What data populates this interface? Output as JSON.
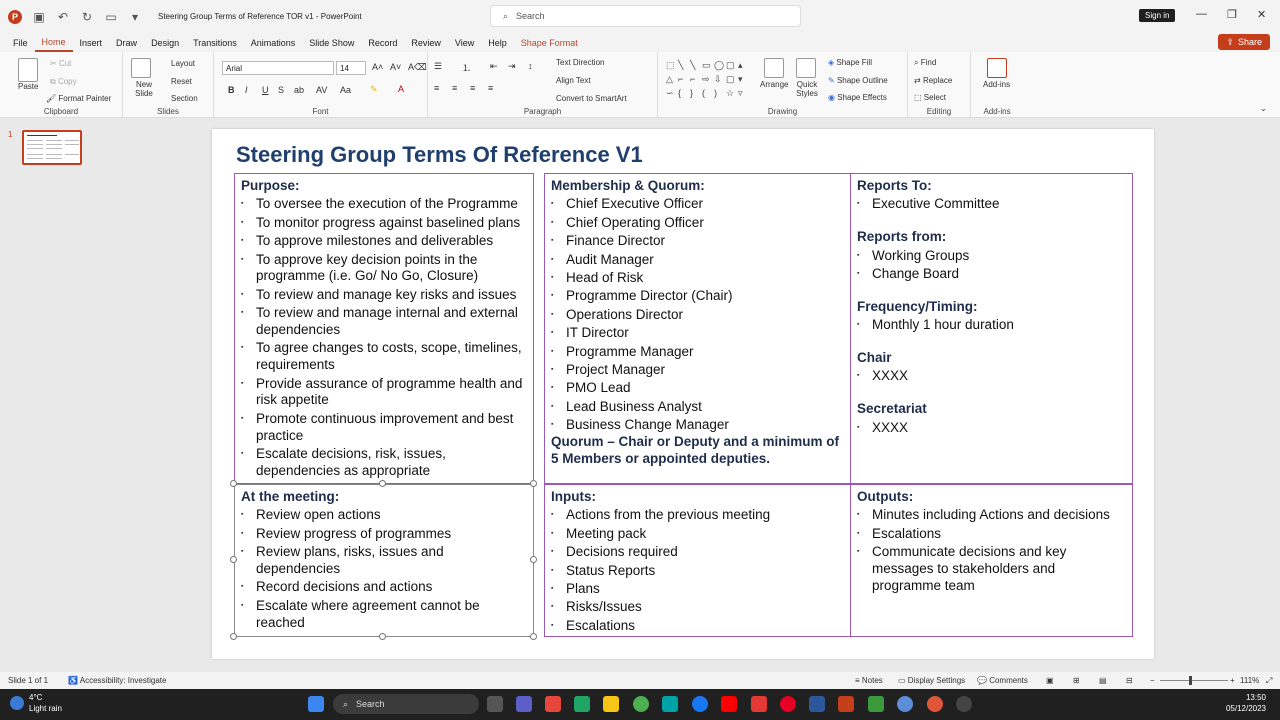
{
  "titlebar": {
    "doc_title": "Steering Group Terms of Reference TOR v1  -  PowerPoint",
    "search_placeholder": "Search",
    "signin": "Sign in",
    "share": "Share"
  },
  "menu": [
    "File",
    "Home",
    "Insert",
    "Draw",
    "Design",
    "Transitions",
    "Animations",
    "Slide Show",
    "Record",
    "Review",
    "View",
    "Help",
    "Shape Format"
  ],
  "ribbon": {
    "clipboard": {
      "paste": "Paste",
      "cut": "Cut",
      "copy": "Copy",
      "format_painter": "Format Painter",
      "label": "Clipboard"
    },
    "slides": {
      "new_slide": "New Slide",
      "layout": "Layout",
      "reset": "Reset",
      "section": "Section",
      "label": "Slides"
    },
    "font": {
      "name": "Arial",
      "size": "14",
      "label": "Font"
    },
    "paragraph": {
      "text_direction": "Text Direction",
      "align_text": "Align Text",
      "convert": "Convert to SmartArt",
      "label": "Paragraph"
    },
    "drawing": {
      "arrange": "Arrange",
      "quick_styles": "Quick Styles",
      "shape_fill": "Shape Fill",
      "shape_outline": "Shape Outline",
      "shape_effects": "Shape Effects",
      "label": "Drawing"
    },
    "editing": {
      "find": "Find",
      "replace": "Replace",
      "select": "Select",
      "label": "Editing"
    },
    "addins": {
      "addins": "Add-ins",
      "label": "Add-ins"
    }
  },
  "thumbs": {
    "number": "1"
  },
  "slide": {
    "title": "Steering Group Terms Of Reference V1",
    "purpose": {
      "heading": "Purpose:",
      "items": [
        "To oversee the execution of the Programme",
        "To monitor progress against baselined plans",
        "To approve milestones and deliverables",
        "To approve key decision points in the programme (i.e. Go/ No Go, Closure)",
        "To review and manage key risks and issues",
        "To review and manage internal and external dependencies",
        "To agree changes to costs, scope, timelines, requirements",
        "Provide assurance of programme health and risk appetite",
        "Promote continuous improvement and best practice",
        "Escalate decisions, risk, issues, dependencies as appropriate"
      ]
    },
    "membership": {
      "heading": "Membership & Quorum:",
      "items": [
        "Chief Executive Officer",
        "Chief Operating Officer",
        "Finance Director",
        "Audit Manager",
        "Head of Risk",
        "Programme Director (Chair)",
        "Operations Director",
        "IT Director",
        "Programme Manager",
        "Project Manager",
        "PMO Lead",
        "Lead Business Analyst",
        "Business Change Manager"
      ],
      "quorum": "Quorum – Chair or Deputy and a minimum of 5 Members or appointed deputies."
    },
    "reports": {
      "to_heading": "Reports To:",
      "to_items": [
        "Executive Committee"
      ],
      "from_heading": "Reports from:",
      "from_items": [
        "Working Groups",
        "Change Board"
      ],
      "freq_heading": "Frequency/Timing:",
      "freq_items": [
        "Monthly 1 hour duration"
      ],
      "chair_heading": "Chair",
      "chair_items": [
        "XXXX"
      ],
      "sec_heading": "Secretariat",
      "sec_items": [
        "XXXX"
      ]
    },
    "meeting": {
      "heading": "At the meeting:",
      "items": [
        "Review open actions",
        "Review progress of programmes",
        "Review plans, risks, issues and dependencies",
        "Record decisions and actions",
        "Escalate where agreement cannot be reached"
      ]
    },
    "inputs": {
      "heading": "Inputs:",
      "items": [
        "Actions from the previous meeting",
        "Meeting pack",
        "Decisions required",
        "Status Reports",
        "Plans",
        "Risks/Issues",
        "Escalations"
      ]
    },
    "outputs": {
      "heading": "Outputs:",
      "items": [
        "Minutes including Actions and decisions",
        "Escalations",
        "Communicate decisions and key messages to stakeholders and programme team"
      ]
    }
  },
  "status": {
    "slide_of": "Slide 1 of 1",
    "accessibility": "Accessibility: Investigate",
    "notes": "Notes",
    "display": "Display Settings",
    "comments": "Comments",
    "zoom": "111%"
  },
  "taskbar": {
    "temp": "4°C",
    "weather": "Light rain",
    "search": "Search",
    "time": "13:50",
    "date": "05/12/2023"
  },
  "colors": {
    "accent": "#c43e1c",
    "title": "#1f3f6e",
    "table_border": "#9b59b6"
  }
}
